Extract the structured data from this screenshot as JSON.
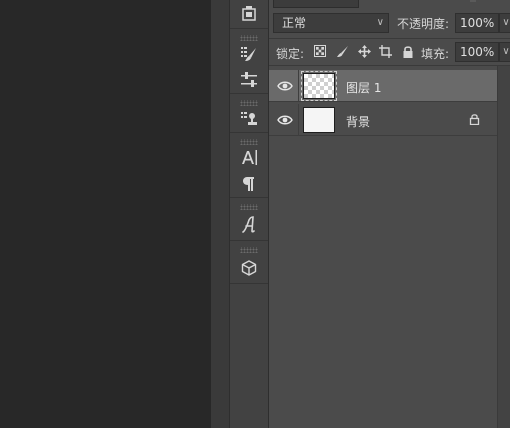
{
  "tools": [
    {
      "name": "3d-camera-icon"
    },
    {
      "name": "brush-presets-icon"
    },
    {
      "name": "adjust-sliders-icon"
    },
    {
      "name": "clone-source-icon"
    },
    {
      "name": "character-icon"
    },
    {
      "name": "paragraph-icon"
    },
    {
      "name": "glyphs-icon"
    },
    {
      "name": "3d-cube-icon"
    }
  ],
  "layers_panel": {
    "blend_mode": "正常",
    "opacity_label": "不透明度:",
    "opacity_value": "100%",
    "lock_label": "锁定:",
    "fill_label": "填充:",
    "fill_value": "100%",
    "layers": [
      {
        "name": "图层 1",
        "selected": true,
        "thumbnail": "transparent",
        "locked": false,
        "visible": true
      },
      {
        "name": "背景",
        "selected": false,
        "thumbnail": "white",
        "locked": true,
        "visible": true
      }
    ]
  },
  "colors": {
    "canvas_bg": "#282828",
    "panel_bg": "#4b4b4b",
    "selected_row": "#6a6a6a"
  }
}
